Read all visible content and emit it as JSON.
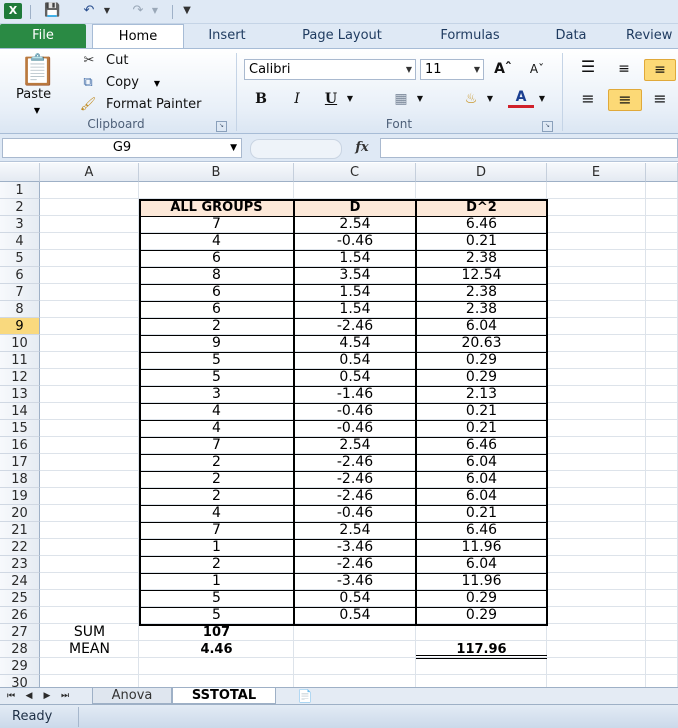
{
  "qat": {
    "logo": "X",
    "save_icon": "save-icon",
    "undo_icon": "undo-icon",
    "redo_icon": "redo-icon"
  },
  "tabs": [
    "File",
    "Home",
    "Insert",
    "Page Layout",
    "Formulas",
    "Data",
    "Review"
  ],
  "ribbon": {
    "clipboard": {
      "paste": "Paste",
      "cut": "Cut",
      "copy": "Copy",
      "format_painter": "Format Painter",
      "group_label": "Clipboard"
    },
    "font": {
      "font_name": "Calibri",
      "font_size": "11",
      "bold": "B",
      "italic": "I",
      "underline": "U",
      "group_label": "Font"
    }
  },
  "formula_bar": {
    "name_box": "G9",
    "fx": "fx",
    "formula": ""
  },
  "columns": [
    "A",
    "B",
    "C",
    "D",
    "E"
  ],
  "rows": [
    "1",
    "2",
    "3",
    "4",
    "5",
    "6",
    "7",
    "8",
    "9",
    "10",
    "11",
    "12",
    "13",
    "14",
    "15",
    "16",
    "17",
    "18",
    "19",
    "20",
    "21",
    "22",
    "23",
    "24",
    "25",
    "26",
    "27",
    "28",
    "29",
    "30"
  ],
  "selected_row": "9",
  "table": {
    "headers": [
      "ALL GROUPS",
      "D",
      "D^2"
    ],
    "data": [
      [
        "7",
        "2.54",
        "6.46"
      ],
      [
        "4",
        "-0.46",
        "0.21"
      ],
      [
        "6",
        "1.54",
        "2.38"
      ],
      [
        "8",
        "3.54",
        "12.54"
      ],
      [
        "6",
        "1.54",
        "2.38"
      ],
      [
        "6",
        "1.54",
        "2.38"
      ],
      [
        "2",
        "-2.46",
        "6.04"
      ],
      [
        "9",
        "4.54",
        "20.63"
      ],
      [
        "5",
        "0.54",
        "0.29"
      ],
      [
        "5",
        "0.54",
        "0.29"
      ],
      [
        "3",
        "-1.46",
        "2.13"
      ],
      [
        "4",
        "-0.46",
        "0.21"
      ],
      [
        "4",
        "-0.46",
        "0.21"
      ],
      [
        "7",
        "2.54",
        "6.46"
      ],
      [
        "2",
        "-2.46",
        "6.04"
      ],
      [
        "2",
        "-2.46",
        "6.04"
      ],
      [
        "2",
        "-2.46",
        "6.04"
      ],
      [
        "4",
        "-0.46",
        "0.21"
      ],
      [
        "7",
        "2.54",
        "6.46"
      ],
      [
        "1",
        "-3.46",
        "11.96"
      ],
      [
        "2",
        "-2.46",
        "6.04"
      ],
      [
        "1",
        "-3.46",
        "11.96"
      ],
      [
        "5",
        "0.54",
        "0.29"
      ],
      [
        "5",
        "0.54",
        "0.29"
      ]
    ],
    "sum_label": "SUM",
    "sum_value": "107",
    "mean_label": "MEAN",
    "mean_value": "4.46",
    "d2_total": "117.96"
  },
  "sheets": [
    "Anova",
    "SSTOTAL"
  ],
  "active_sheet": "SSTOTAL",
  "status": "Ready",
  "colors": {
    "file_tab": "#2a8a44",
    "header_fill": "#fde9d9",
    "selected_row": "#f9d97e"
  }
}
